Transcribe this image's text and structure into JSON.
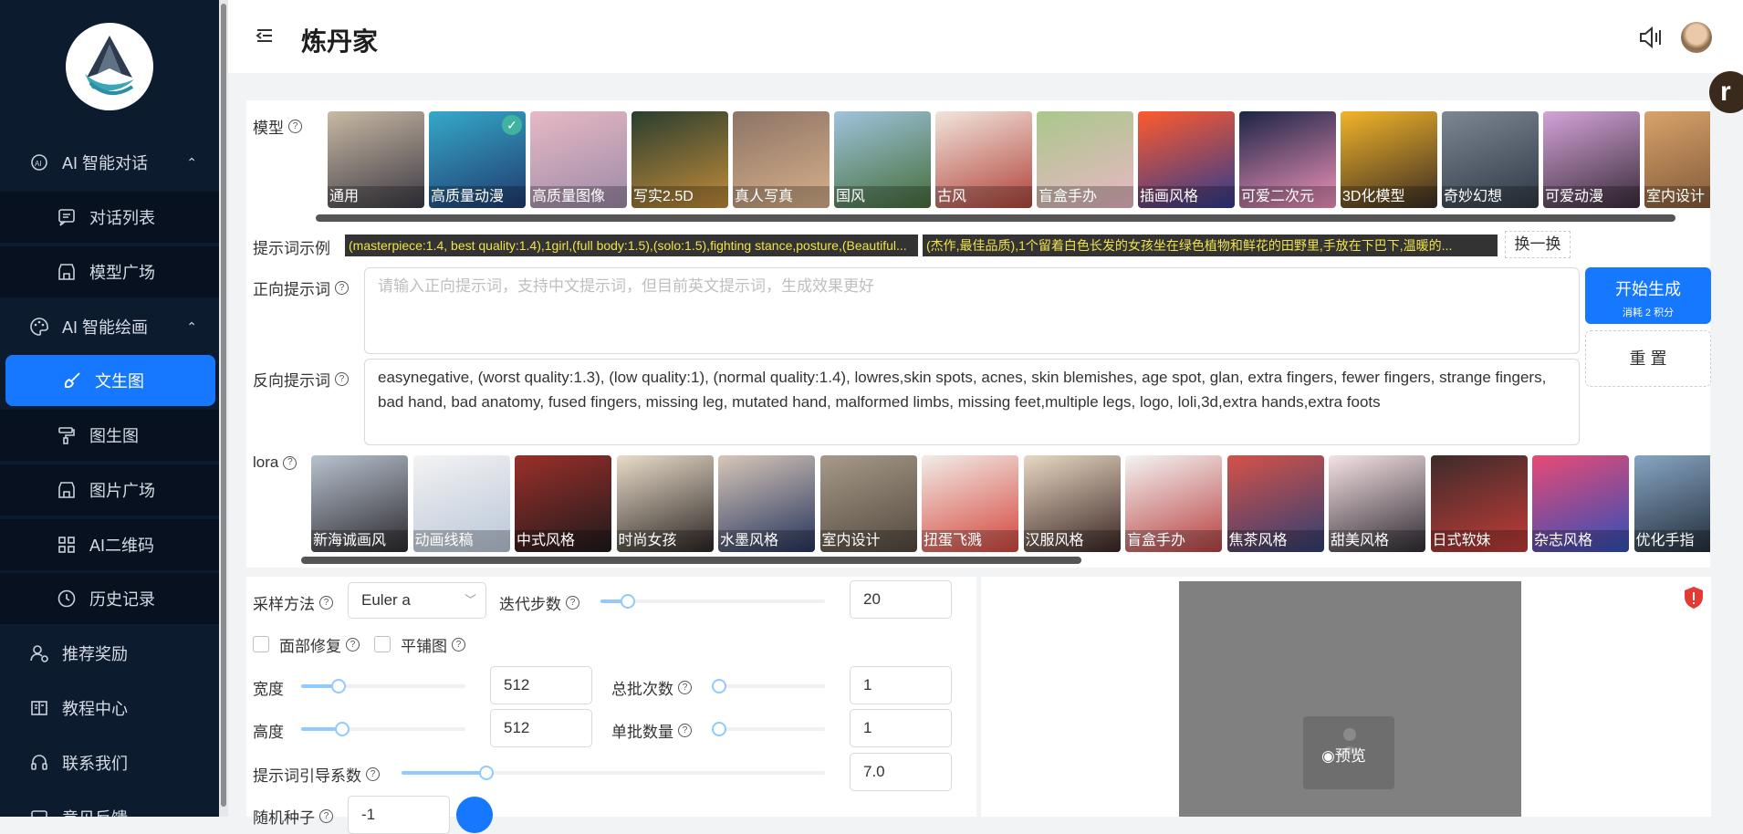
{
  "sidebar": {
    "items": [
      {
        "label": "AI 智能对话",
        "icon": "chat-ai-icon",
        "type": "top",
        "chevron": "⌃"
      },
      {
        "label": "对话列表",
        "icon": "message-list-icon",
        "type": "sub"
      },
      {
        "label": "模型广场",
        "icon": "store-icon",
        "type": "sub"
      },
      {
        "label": "AI 智能绘画",
        "icon": "palette-icon",
        "type": "top",
        "chevron": "⌃"
      },
      {
        "label": "文生图",
        "icon": "brush-icon",
        "type": "active"
      },
      {
        "label": "图生图",
        "icon": "roller-brush-icon",
        "type": "sub"
      },
      {
        "label": "图片广场",
        "icon": "store-icon",
        "type": "sub"
      },
      {
        "label": "AI二维码",
        "icon": "qrcode-icon",
        "type": "sub"
      },
      {
        "label": "历史记录",
        "icon": "clock-icon",
        "type": "sub"
      },
      {
        "label": "推荐奖励",
        "icon": "user-reward-icon",
        "type": "top"
      },
      {
        "label": "教程中心",
        "icon": "book-icon",
        "type": "top"
      },
      {
        "label": "联系我们",
        "icon": "headset-icon",
        "type": "top"
      },
      {
        "label": "意见反馈",
        "icon": "feedback-icon",
        "type": "top"
      }
    ]
  },
  "header": {
    "title": "炼丹家",
    "float_letter": "r"
  },
  "form": {
    "model_label": "模型",
    "models": [
      {
        "name": "通用",
        "colors": [
          "#c9b9a4",
          "#3c3a44"
        ]
      },
      {
        "name": "高质量动漫",
        "colors": [
          "#35a9c9",
          "#203a6e"
        ],
        "selected": true
      },
      {
        "name": "高质量图像",
        "colors": [
          "#e7b9c4",
          "#9c8aa8"
        ]
      },
      {
        "name": "写实2.5D",
        "colors": [
          "#2a3e2f",
          "#c28c3a"
        ]
      },
      {
        "name": "真人写真",
        "colors": [
          "#8d7466",
          "#d7b08a"
        ]
      },
      {
        "name": "国风",
        "colors": [
          "#9fc3dc",
          "#456e3a"
        ]
      },
      {
        "name": "古风",
        "colors": [
          "#f1e5dc",
          "#b1433a"
        ]
      },
      {
        "name": "盲盒手办",
        "colors": [
          "#a9c88b",
          "#e9b7c4"
        ]
      },
      {
        "name": "插画风格",
        "colors": [
          "#ff5a2c",
          "#2d3b8f"
        ]
      },
      {
        "name": "可爱二次元",
        "colors": [
          "#1b2445",
          "#ef93b9"
        ]
      },
      {
        "name": "3D化模型",
        "colors": [
          "#f2b428",
          "#3a2c24"
        ]
      },
      {
        "name": "奇妙幻想",
        "colors": [
          "#7d8794",
          "#2e3945"
        ]
      },
      {
        "name": "可爱动漫",
        "colors": [
          "#d3a4d8",
          "#3b2b3a"
        ]
      },
      {
        "name": "室内设计",
        "colors": [
          "#d9a26b",
          "#7a5434"
        ]
      }
    ],
    "example_label": "提示词示例",
    "examples": [
      "(masterpiece:1.4, best quality:1.4),1girl,(full body:1.5),(solo:1.5),fighting stance,posture,(Beautiful...",
      "(杰作,最佳品质),1个留着白色长发的女孩坐在绿色植物和鲜花的田野里,手放在下巴下,温暖的..."
    ],
    "refresh_label": "换一换",
    "positive_label": "正向提示词",
    "positive_placeholder": "请输入正向提示词，支持中文提示词，但目前英文提示词，生成效果更好",
    "negative_label": "反向提示词",
    "negative_value": "easynegative, (worst quality:1.3), (low quality:1), (normal quality:1.4), lowres,skin spots, acnes, skin blemishes, age spot, glan, extra fingers, fewer fingers, strange fingers, bad hand, bad anatomy, fused fingers, missing leg, mutated hand, malformed limbs, missing feet,multiple legs, logo, loli,3d,extra hands,extra foots",
    "generate_label": "开始生成",
    "generate_cost": "消耗 2 积分",
    "reset_label": "重 置",
    "lora_label": "lora",
    "loras": [
      {
        "name": "新海诚画风",
        "colors": [
          "#b8c2cf",
          "#2c2a2e"
        ]
      },
      {
        "name": "动画线稿",
        "colors": [
          "#f3f3f3",
          "#b9c6d8"
        ]
      },
      {
        "name": "中式风格",
        "colors": [
          "#9b2f2a",
          "#1e1a1c"
        ]
      },
      {
        "name": "时尚女孩",
        "colors": [
          "#e9dcc9",
          "#2b2523"
        ]
      },
      {
        "name": "水墨风格",
        "colors": [
          "#d8c7b9",
          "#24335c"
        ]
      },
      {
        "name": "室内设计",
        "colors": [
          "#a79a89",
          "#52483d"
        ]
      },
      {
        "name": "扭蛋飞溅",
        "colors": [
          "#f2ece7",
          "#d4463c"
        ]
      },
      {
        "name": "汉服风格",
        "colors": [
          "#e9d8c4",
          "#3a2522"
        ]
      },
      {
        "name": "盲盒手办",
        "colors": [
          "#f4f4f4",
          "#b84040"
        ]
      },
      {
        "name": "焦茶风格",
        "colors": [
          "#d55248",
          "#2f3f73"
        ]
      },
      {
        "name": "甜美风格",
        "colors": [
          "#f6e2e4",
          "#2f2b33"
        ]
      },
      {
        "name": "日式软妹",
        "colors": [
          "#3d2b2a",
          "#c23c38"
        ]
      },
      {
        "name": "杂志风格",
        "colors": [
          "#e94a75",
          "#2f4fb8"
        ]
      },
      {
        "name": "优化手指",
        "colors": [
          "#87a6c3",
          "#1d2633"
        ]
      }
    ]
  },
  "params": {
    "sampler_label": "采样方法",
    "sampler_value": "Euler a",
    "steps_label": "迭代步数",
    "steps_value": "20",
    "steps_fraction": 0.12,
    "face_fix_label": "面部修复",
    "tile_label": "平铺图",
    "width_label": "宽度",
    "width_value": "512",
    "width_fraction": 0.23,
    "height_label": "高度",
    "height_value": "512",
    "height_fraction": 0.25,
    "batch_count_label": "总批次数",
    "batch_count_value": "1",
    "batch_count_fraction": 0.0,
    "batch_size_label": "单批数量",
    "batch_size_value": "1",
    "batch_size_fraction": 0.0,
    "cfg_label": "提示词引导系数",
    "cfg_value": "7.0",
    "cfg_fraction": 0.2,
    "seed_label": "随机种子",
    "seed_value": "-1"
  },
  "preview": {
    "label": "预览"
  },
  "colors": {
    "accent": "#1677ff",
    "sidebar_bg": "#0d1b2e",
    "slider": "#91caff"
  }
}
